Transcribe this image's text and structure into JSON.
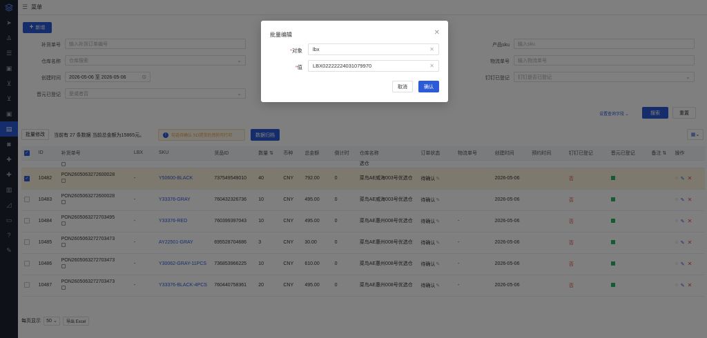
{
  "colors": {
    "accent": "#2d5bd7",
    "sidebar": "#1f2230",
    "selected_row": "#fdf3dc",
    "warn": "#e6a23c",
    "red": "#e54d42",
    "green": "#2db464"
  },
  "topbar": {
    "menu_icon": "menu-icon",
    "title": "菜单"
  },
  "add_button": {
    "label": "新增"
  },
  "filters": {
    "row1": [
      {
        "label": "补货单号",
        "placeholder": "输入补货订单编号"
      },
      {
        "label": "产品sku",
        "placeholder": "输入sku"
      }
    ],
    "row2": [
      {
        "label": "仓库名称",
        "placeholder": "仓库搜索"
      },
      {
        "label": "物流单号",
        "placeholder": "输入物流单号"
      }
    ],
    "row3": [
      {
        "label": "创建时间",
        "value": "2026-05-06 至 2026-05-06"
      },
      {
        "label": "钉钉已登记",
        "placeholder": "钉钉是否已登记"
      }
    ],
    "row4": [
      {
        "label": "晋元已登记",
        "placeholder": "是或者否"
      }
    ],
    "settings_link": "设置查询字段",
    "search_button": "搜索",
    "reset_button": "重置"
  },
  "toolbar": {
    "batch_edit": "批量修改",
    "summary": "当前有 27 条数据 当前总金额为15865元。",
    "warning": "勾选待确认 SO提货仍然的可打印",
    "sync_button": "数据归档"
  },
  "table": {
    "headers": [
      "",
      "ID",
      "补货单号",
      "LBX",
      "SKU",
      "货品ID",
      "数量",
      "币种",
      "总金额",
      "倒计时",
      "仓库名称",
      "订单状态",
      "物流单号",
      "创建时间",
      "预约时间",
      "钉钉已登记",
      "晋元已登记",
      "备注",
      "操作"
    ],
    "rows": [
      {
        "selected": true,
        "id": "10482",
        "order": "PON2605063272600028",
        "lbx": "",
        "sku": "Y50600-BLACK",
        "goods_id": "737549549010",
        "qty": "40",
        "currency": "CNY",
        "amount": "792.00",
        "countdown": "0",
        "warehouse": "菜鸟AE威海003号优选仓",
        "status": "待确认",
        "tracking": "",
        "created": "2026-05-06",
        "appoint": "",
        "dingtalk": "否",
        "remark": ""
      },
      {
        "selected": false,
        "id": "10483",
        "order": "PON2605063272600028",
        "lbx": "",
        "sku": "Y33376-GRAY",
        "goods_id": "760432326736",
        "qty": "10",
        "currency": "CNY",
        "amount": "495.00",
        "countdown": "0",
        "warehouse": "菜鸟AE威海003号优选仓",
        "status": "待确认",
        "tracking": "",
        "created": "2026-05-06",
        "appoint": "",
        "dingtalk": "否",
        "remark": ""
      },
      {
        "selected": false,
        "id": "10484",
        "order": "PON2605063272703495",
        "lbx": "",
        "sku": "Y33376-RED",
        "goods_id": "760399397043",
        "qty": "10",
        "currency": "CNY",
        "amount": "495.00",
        "countdown": "0",
        "warehouse": "菜鸟AE惠州008号优选仓",
        "status": "待确认",
        "tracking": "-",
        "created": "2026-05-06",
        "appoint": "",
        "dingtalk": "否",
        "remark": ""
      },
      {
        "selected": false,
        "id": "10485",
        "order": "PON2605063272703473",
        "lbx": "",
        "sku": "AY22501-GRAY",
        "goods_id": "695528704686",
        "qty": "3",
        "currency": "CNY",
        "amount": "30.00",
        "countdown": "0",
        "warehouse": "菜鸟AE惠州008号优选仓",
        "status": "待确认",
        "tracking": "-",
        "created": "2026-05-06",
        "appoint": "",
        "dingtalk": "否",
        "remark": ""
      },
      {
        "selected": false,
        "id": "10486",
        "order": "PON2605063272703473",
        "lbx": "",
        "sku": "Y30062-GRAY-11PCS",
        "goods_id": "736853966225",
        "qty": "10",
        "currency": "CNY",
        "amount": "610.00",
        "countdown": "0",
        "warehouse": "菜鸟AE惠州008号优选仓",
        "status": "待确认",
        "tracking": "-",
        "created": "2026-05-06",
        "appoint": "",
        "dingtalk": "否",
        "remark": ""
      },
      {
        "selected": false,
        "id": "10487",
        "order": "PON2605063272703473",
        "lbx": "",
        "sku": "Y33376-BLACK-4PCS",
        "goods_id": "760440758361",
        "qty": "20",
        "currency": "CNY",
        "amount": "495.00",
        "countdown": "0",
        "warehouse": "菜鸟AE惠州008号优选仓",
        "status": "待确认",
        "tracking": "-",
        "created": "2026-05-06",
        "appoint": "",
        "dingtalk": "否",
        "remark": ""
      }
    ]
  },
  "footer": {
    "per_page_label": "每页显示",
    "per_page_value": "50",
    "export_button": "导出 Excel"
  },
  "modal": {
    "title": "批量编辑",
    "field1_label": "对象",
    "field1_value": "lbx",
    "field2_label": "值",
    "field2_value": "LBX02222224031079970",
    "cancel": "取消",
    "confirm": "确认"
  }
}
